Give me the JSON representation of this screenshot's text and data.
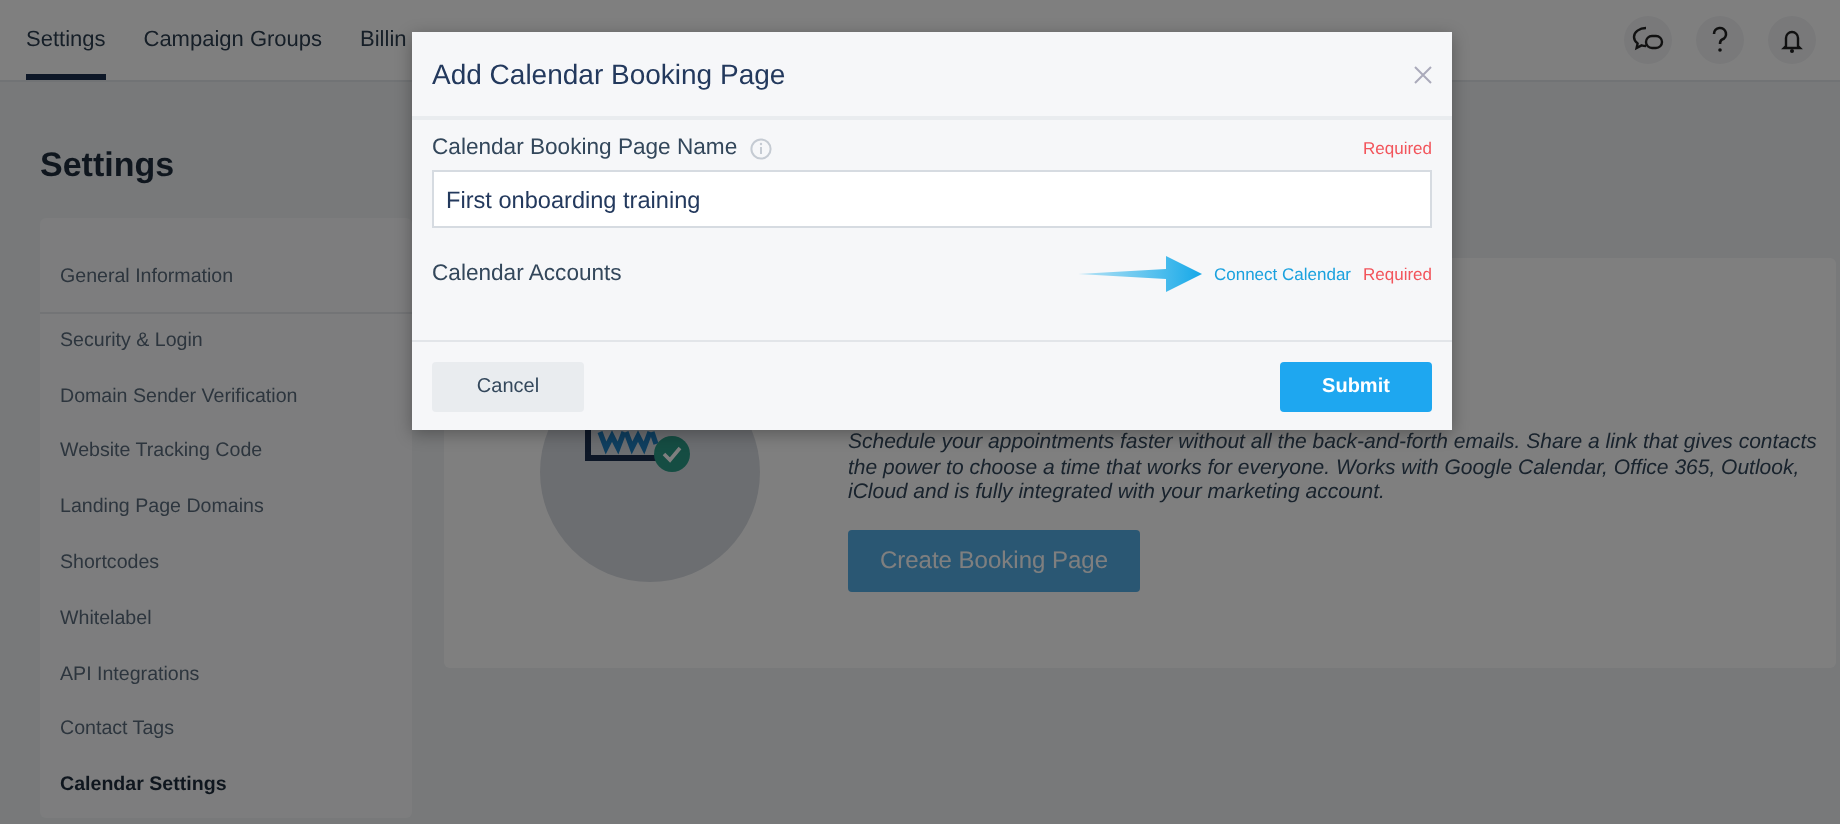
{
  "nav": {
    "tabs": [
      {
        "label": "Settings",
        "selected": true
      },
      {
        "label": "Campaign Groups",
        "selected": false
      },
      {
        "label": "Billin",
        "selected": false
      }
    ]
  },
  "page": {
    "title": "Settings"
  },
  "sidebar": {
    "items": [
      {
        "label": "General Information",
        "selected": false
      },
      {
        "label": "Security & Login",
        "selected": false
      },
      {
        "label": "Domain Sender Verification",
        "selected": false
      },
      {
        "label": "Website Tracking Code",
        "selected": false
      },
      {
        "label": "Landing Page Domains",
        "selected": false
      },
      {
        "label": "Shortcodes",
        "selected": false
      },
      {
        "label": "Whitelabel",
        "selected": false
      },
      {
        "label": "API Integrations",
        "selected": false
      },
      {
        "label": "Contact Tags",
        "selected": false
      },
      {
        "label": "Calendar Settings",
        "selected": true
      }
    ]
  },
  "card": {
    "description": "Schedule your appointments faster without all the back-and-forth emails. Share a link that gives contacts the power to choose a time that works for everyone. Works with Google Calendar, Office 365, Outlook, iCloud and is fully integrated with your marketing account.",
    "button": "Create Booking Page"
  },
  "modal": {
    "title": "Add Calendar Booking Page",
    "fields": [
      {
        "kind": "text",
        "label": "Calendar Booking Page Name",
        "required": "Required",
        "value": "First onboarding training"
      },
      {
        "kind": "accounts",
        "label": "Calendar Accounts",
        "link": "Connect Calendar",
        "required": "Required"
      }
    ],
    "buttons": [
      {
        "kind": "secondary",
        "label": "Cancel"
      },
      {
        "kind": "primary",
        "label": "Submit"
      }
    ]
  }
}
